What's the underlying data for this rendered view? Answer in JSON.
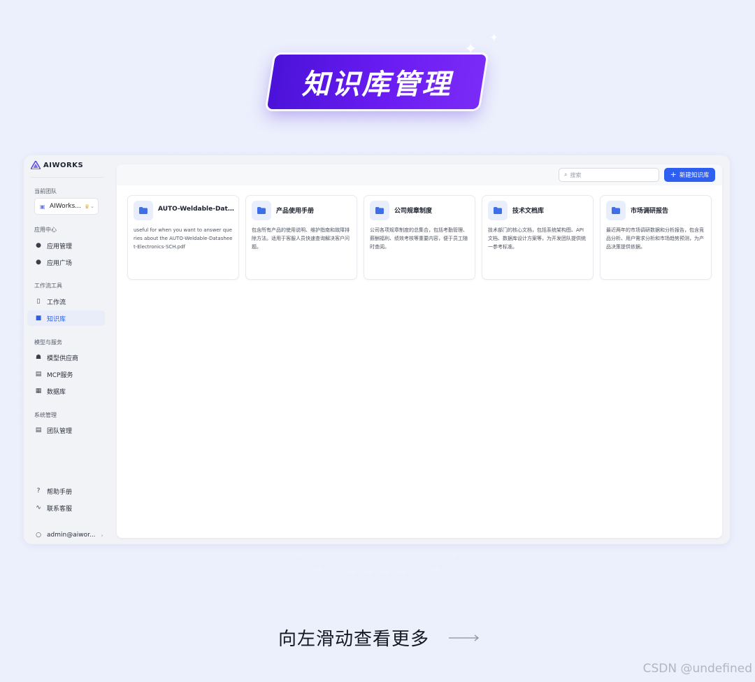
{
  "banner": {
    "title": "知识库管理"
  },
  "app": {
    "brand": "AIWORKS",
    "sidebar": {
      "current_team_label": "当前团队",
      "team_name": "AIWorks...",
      "sections": [
        {
          "label": "应用中心",
          "items": [
            "应用管理",
            "应用广场"
          ]
        },
        {
          "label": "工作流工具",
          "items": [
            "工作流",
            "知识库"
          ]
        },
        {
          "label": "模型与服务",
          "items": [
            "模型供应商",
            "MCP服务",
            "数据库"
          ]
        },
        {
          "label": "系统管理",
          "items": [
            "团队管理"
          ]
        }
      ],
      "footer_items": [
        "帮助手册",
        "联系客服"
      ],
      "user": "admin@aiwor..."
    },
    "toolbar": {
      "search_placeholder": "搜索",
      "new_button": "新建知识库"
    },
    "cards": [
      {
        "title": "AUTO-Weldable-Data...",
        "desc": "useful for when you want to answer queries about the AUTO-Weldable-Datasheet-Electronics-SCH.pdf"
      },
      {
        "title": "产品使用手册",
        "desc": "包含所有产品的使用说明、维护指南和故障排除方法。适用于客服人员快速查询解决客户问题。"
      },
      {
        "title": "公司规章制度",
        "desc": "公司各项规章制度的总集合，包括考勤管理、薪酬福利、绩效考核等重要内容，便于员工随时查阅。"
      },
      {
        "title": "技术文档库",
        "desc": "技术部门的核心文档，包括系统架构图、API文档、数据库设计方案等，为开发团队提供统一参考标准。"
      },
      {
        "title": "市场调研报告",
        "desc": "最近两年的市场调研数据和分析报告，包含竞品分析、用户需求分析和市场趋势预测，为产品决策提供依据。"
      }
    ]
  },
  "cta": "向左滑动查看更多",
  "watermark": "CSDN @undefined",
  "colors": {
    "accent": "#2f5ff0",
    "banner": "#5a17e8",
    "active_bg": "#e9ecf9"
  }
}
